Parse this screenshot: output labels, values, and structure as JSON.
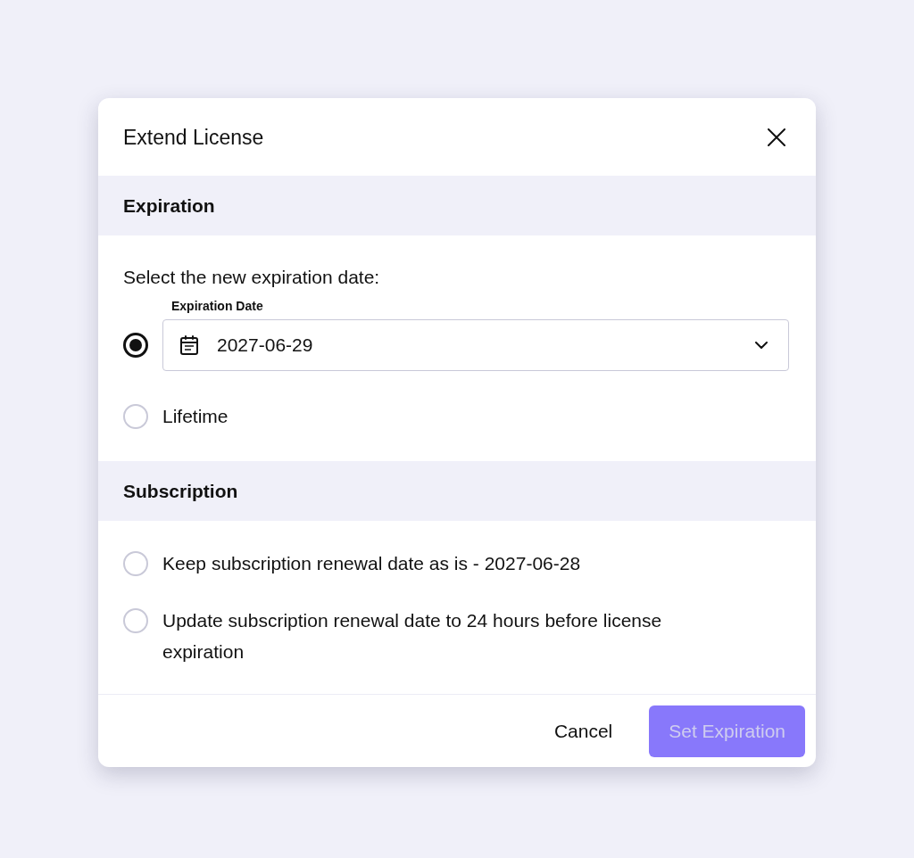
{
  "dialog": {
    "title": "Extend License"
  },
  "sections": [
    {
      "heading": "Expiration",
      "prompt": "Select the new expiration date:",
      "options": [
        {
          "kind": "date",
          "selected": true,
          "field_label": "Expiration Date",
          "value": "2027-06-29"
        },
        {
          "kind": "text",
          "selected": false,
          "label": "Lifetime"
        }
      ]
    },
    {
      "heading": "Subscription",
      "options": [
        {
          "kind": "text",
          "selected": false,
          "label": "Keep subscription renewal date as is - 2027-06-28"
        },
        {
          "kind": "text",
          "selected": false,
          "label": "Update subscription renewal date to 24 hours before license expiration"
        }
      ]
    }
  ],
  "buttons": [
    {
      "kind": "text",
      "label": "Cancel",
      "disabled": false
    },
    {
      "kind": "primary",
      "label": "Set Expiration",
      "disabled": true
    }
  ]
}
